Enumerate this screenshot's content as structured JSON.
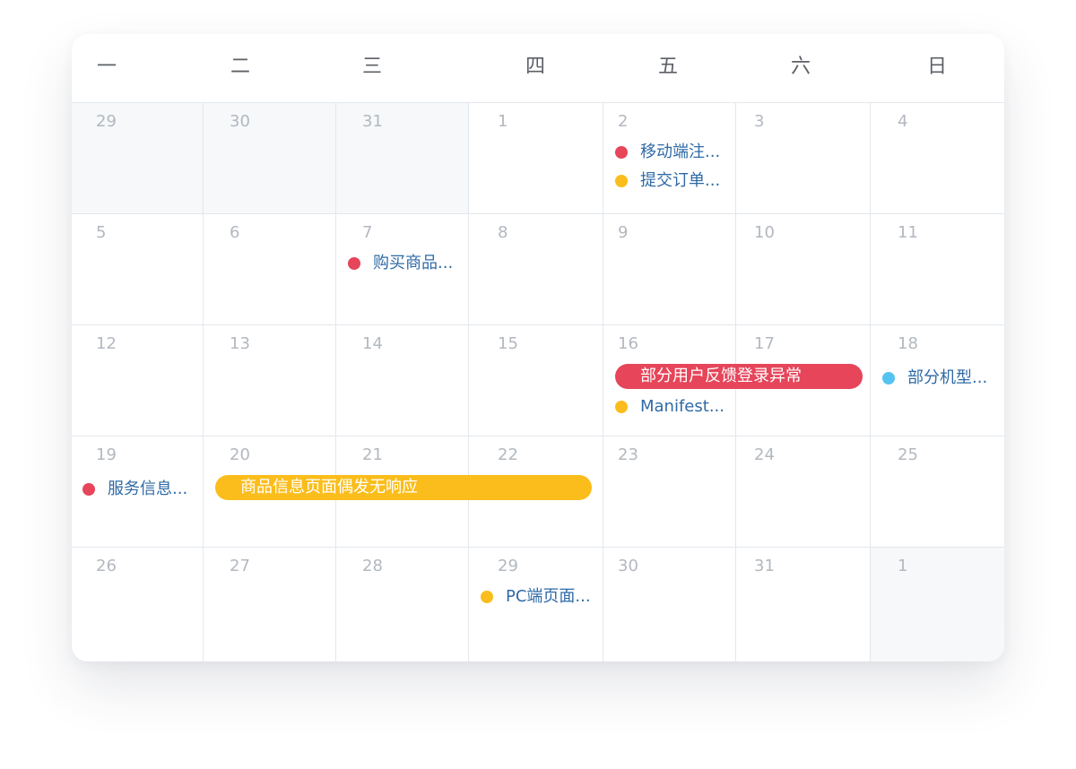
{
  "weekdays": [
    "一",
    "二",
    "三",
    "四",
    "五",
    "六",
    "日"
  ],
  "colors": {
    "red": "#e6455a",
    "yellow": "#fbbd1b",
    "blue": "#55c3f0"
  },
  "weeks": [
    [
      "29",
      "30",
      "31",
      "1",
      "2",
      "3",
      "4"
    ],
    [
      "5",
      "6",
      "7",
      "8",
      "9",
      "10",
      "11"
    ],
    [
      "12",
      "13",
      "14",
      "15",
      "16",
      "17",
      "18"
    ],
    [
      "19",
      "20",
      "21",
      "22",
      "23",
      "24",
      "25"
    ],
    [
      "26",
      "27",
      "28",
      "29",
      "30",
      "31",
      "1"
    ]
  ],
  "events": {
    "mobile_register": "移动端注...",
    "submit_order": "提交订单...",
    "buy_goods": "购买商品...",
    "login_feedback": "部分用户反馈登录异常",
    "manifest": "Manifest...",
    "some_models": "部分机型...",
    "service_info": "服务信息...",
    "goods_page_unresponsive": "商品信息页面偶发无响应",
    "pc_page": "PC端页面..."
  }
}
